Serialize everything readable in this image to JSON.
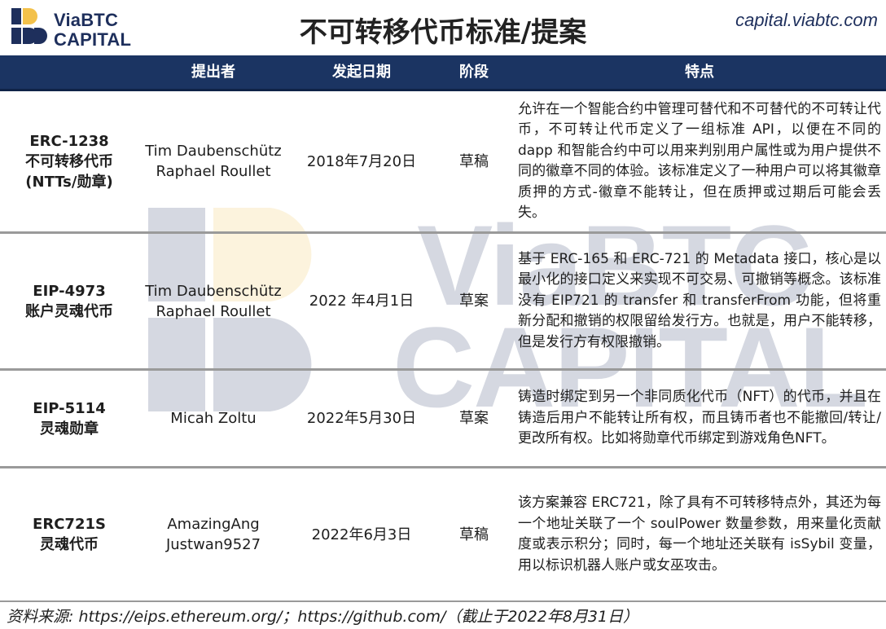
{
  "header": {
    "brand_line1": "ViaBTC",
    "brand_line2": "CAPITAL",
    "title": "不可转移代币标准/提案",
    "site": "capital.viabtc.com"
  },
  "colors": {
    "navy": "#1b3462",
    "gold": "#f3c14b",
    "separator": "#9a9a9a"
  },
  "table": {
    "headers": [
      "",
      "提出者",
      "发起日期",
      "阶段",
      "特点"
    ],
    "rows": [
      {
        "name_lines": [
          "ERC-1238",
          "不可转移代币",
          "(NTTs/勋章)"
        ],
        "proposer_lines": [
          "Tim Daubenschütz",
          "Raphael Roullet"
        ],
        "date": "2018年7月20日",
        "stage": "草稿",
        "feature": "允许在一个智能合约中管理可替代和不可替代的不可转让代币，不可转让代币定义了一组标准 API，以便在不同的 dapp 和智能合约中可以用来判别用户属性或为用户提供不同的徽章不同的体验。该标准定义了一种用户可以将其徽章质押的方式-徽章不能转让，但在质押或过期后可能会丢失。"
      },
      {
        "name_lines": [
          "EIP-4973",
          "账户灵魂代币"
        ],
        "proposer_lines": [
          "Tim Daubenschütz",
          "Raphael Roullet"
        ],
        "date": "2022 年4月1日",
        "stage": "草案",
        "feature": "基于 ERC-165 和 ERC-721 的 Metadata 接口，核心是以最小化的接口定义来实现不可交易、可撤销等概念。该标准没有 EIP721 的 transfer 和 transferFrom 功能，但将重新分配和撤销的权限留给发行方。也就是，用户不能转移，但是发行方有权限撤销。"
      },
      {
        "name_lines": [
          "EIP-5114",
          "灵魂勋章"
        ],
        "proposer_lines": [
          "Micah Zoltu"
        ],
        "date": "2022年5月30日",
        "stage": "草案",
        "feature": "铸造时绑定到另一个非同质化代币（NFT）的代币，并且在铸造后用户不能转让所有权，而且铸币者也不能撤回/转让/更改所有权。比如将勋章代币绑定到游戏角色NFT。"
      },
      {
        "name_lines": [
          "ERC721S",
          "灵魂代币"
        ],
        "proposer_lines": [
          "AmazingAng",
          "Justwan9527"
        ],
        "date": "2022年6月3日",
        "stage": "草稿",
        "feature": "该方案兼容 ERC721，除了具有不可转移特点外，其还为每一个地址关联了一个 soulPower 数量参数，用来量化贡献度或表示积分；同时，每一个地址还关联有 isSybil 变量，用以标识机器人账户或女巫攻击。"
      }
    ]
  },
  "watermark": {
    "line1": "ViaBTC",
    "line2": "CAPITAL"
  },
  "footer": {
    "source": "资料来源: https://eips.ethereum.org/；https://github.com/（截止于2022年8月31日）"
  }
}
